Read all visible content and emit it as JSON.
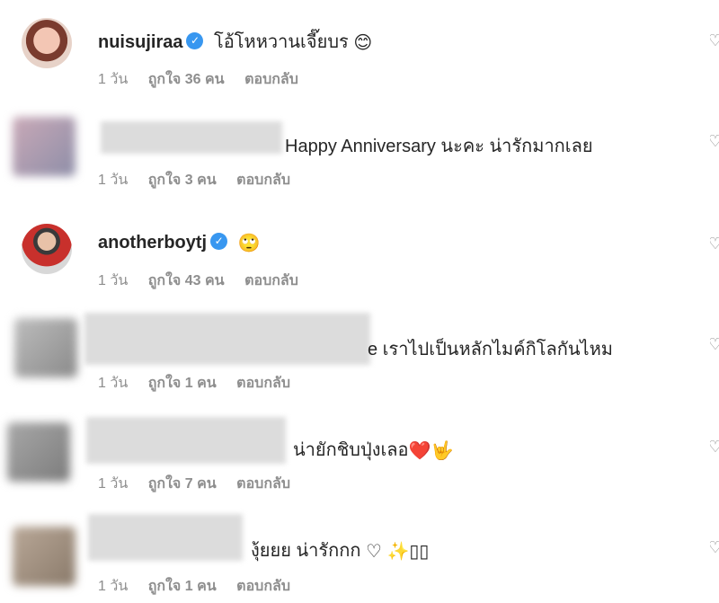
{
  "comments": [
    {
      "username": "nuisujiraa",
      "verified": true,
      "text": "โอ้โหหวานเจี๊ยบร",
      "emoji": "😊",
      "time": "1 วัน",
      "likes": "ถูกใจ 36 คน",
      "reply": "ตอบกลับ"
    },
    {
      "username": "",
      "verified": false,
      "text": "Happy Anniversary นะคะ น่ารักมากเลย",
      "time": "1 วัน",
      "likes": "ถูกใจ 3 คน",
      "reply": "ตอบกลับ"
    },
    {
      "username": "anotherboytj",
      "verified": true,
      "text": "",
      "emoji": "🙄",
      "time": "1 วัน",
      "likes": "ถูกใจ 43 คน",
      "reply": "ตอบกลับ"
    },
    {
      "username": "",
      "verified": false,
      "text": "e เราไปเป็นหลักไมค์กิโลกันไหม",
      "time": "1 วัน",
      "likes": "ถูกใจ 1 คน",
      "reply": "ตอบกลับ"
    },
    {
      "username": "",
      "verified": false,
      "text": "น่ายักชิบปุ่งเลอ",
      "emoji": "❤️🤟",
      "time": "1 วัน",
      "likes": "ถูกใจ 7 คน",
      "reply": "ตอบกลับ"
    },
    {
      "username": "",
      "verified": false,
      "text": "งุ้ยยย น่ารักกก",
      "emoji": "♡ ✨▯▯",
      "time": "1 วัน",
      "likes": "ถูกใจ 1 คน",
      "reply": "ตอบกลับ"
    }
  ],
  "icons": {
    "like": "heart-outline-icon",
    "verified": "verified-badge-icon"
  },
  "colors": {
    "verified": "#3897f0",
    "meta": "#8e8e8e",
    "text": "#262626"
  }
}
